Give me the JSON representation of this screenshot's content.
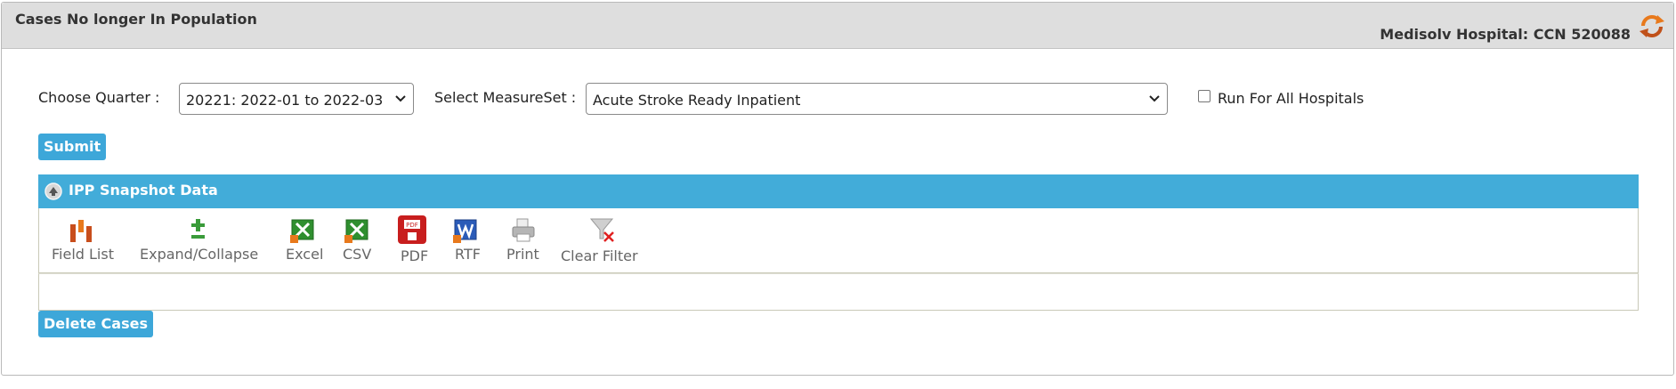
{
  "panel": {
    "title": "Cases No longer In Population",
    "hospital": "Medisolv Hospital: CCN 520088"
  },
  "form": {
    "quarter_label": "Choose Quarter :",
    "quarter_value": "20221: 2022-01 to 2022-03",
    "measureset_label": "Select MeasureSet :",
    "measureset_value": "Acute Stroke Ready Inpatient",
    "run_all_label": "Run For All Hospitals",
    "run_all_checked": false,
    "submit_label": "Submit"
  },
  "grid": {
    "title": "IPP Snapshot Data",
    "toolbar": [
      {
        "label": "Field List",
        "icon": "field-list-icon"
      },
      {
        "label": "Expand/Collapse",
        "icon": "expand-collapse-icon"
      },
      {
        "label": "Excel",
        "icon": "excel-icon"
      },
      {
        "label": "CSV",
        "icon": "csv-icon"
      },
      {
        "label": "PDF",
        "icon": "pdf-icon"
      },
      {
        "label": "RTF",
        "icon": "rtf-icon"
      },
      {
        "label": "Print",
        "icon": "print-icon"
      },
      {
        "label": "Clear Filter",
        "icon": "clear-filter-icon"
      }
    ],
    "delete_label": "Delete Cases"
  },
  "colors": {
    "accent": "#3da7d9",
    "header_bg": "#dedede"
  }
}
